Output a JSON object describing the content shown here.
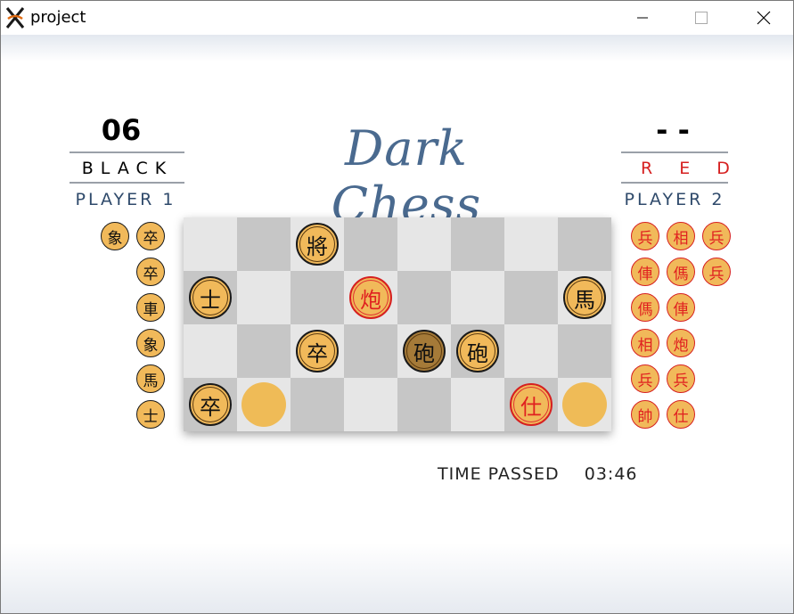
{
  "window": {
    "title": "project"
  },
  "black_side": {
    "score": "06",
    "color_label": "BLACK",
    "player_label": "PLAYER 1"
  },
  "red_side": {
    "score": "- -",
    "color_label": "RED",
    "player_label": "PLAYER 2"
  },
  "game_title": "Dark Chess",
  "time": {
    "label": "TIME PASSED",
    "value": "03:46"
  },
  "board": {
    "rows": 4,
    "cols": 8,
    "light_color": "#e6e6e6",
    "dark_color": "#c6c6c6",
    "pieces": [
      {
        "row": 0,
        "col": 2,
        "char": "將",
        "side": "black",
        "state": "revealed"
      },
      {
        "row": 1,
        "col": 0,
        "char": "士",
        "side": "black",
        "state": "revealed"
      },
      {
        "row": 1,
        "col": 3,
        "char": "炮",
        "side": "red",
        "state": "revealed"
      },
      {
        "row": 1,
        "col": 7,
        "char": "馬",
        "side": "black",
        "state": "revealed"
      },
      {
        "row": 2,
        "col": 2,
        "char": "卒",
        "side": "black",
        "state": "revealed"
      },
      {
        "row": 2,
        "col": 4,
        "char": "砲",
        "side": "black",
        "state": "selected"
      },
      {
        "row": 2,
        "col": 5,
        "char": "砲",
        "side": "black",
        "state": "revealed"
      },
      {
        "row": 3,
        "col": 0,
        "char": "卒",
        "side": "black",
        "state": "revealed"
      },
      {
        "row": 3,
        "col": 1,
        "char": "",
        "side": "",
        "state": "hidden"
      },
      {
        "row": 3,
        "col": 6,
        "char": "仕",
        "side": "red",
        "state": "revealed"
      },
      {
        "row": 3,
        "col": 7,
        "char": "",
        "side": "",
        "state": "hidden"
      }
    ]
  },
  "captured_black": [
    [
      "象",
      "卒"
    ],
    [
      "卒"
    ],
    [
      "車"
    ],
    [
      "象"
    ],
    [
      "馬"
    ],
    [
      "士"
    ]
  ],
  "captured_red": [
    [
      "兵",
      "相",
      "兵"
    ],
    [
      "俥",
      "傌",
      "兵"
    ],
    [
      "傌",
      "俥"
    ],
    [
      "相",
      "炮"
    ],
    [
      "兵",
      "兵"
    ],
    [
      "帥",
      "仕"
    ]
  ],
  "colors": {
    "red": "#e02020",
    "piece_fill": "#f1b95a",
    "title_blue": "#4a6a8f",
    "player_blue": "#2f4a6b"
  }
}
